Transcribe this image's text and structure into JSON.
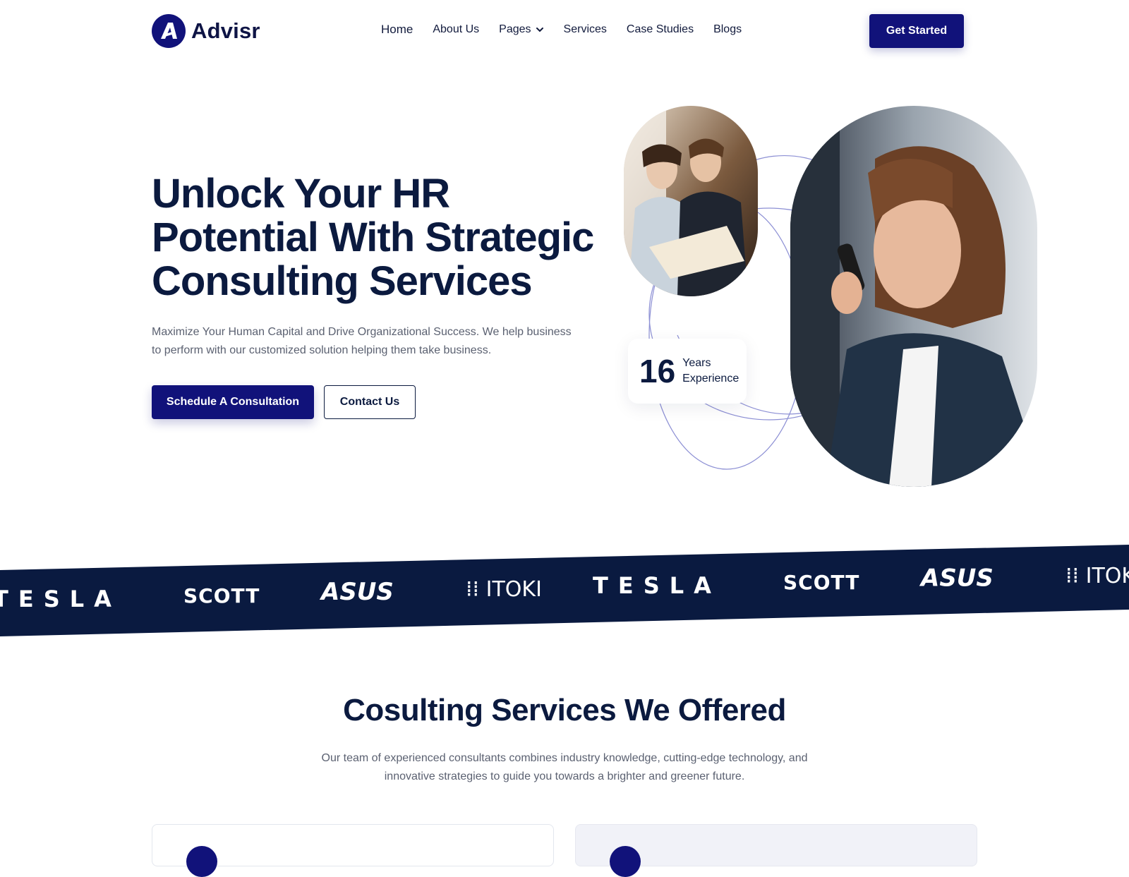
{
  "brand": {
    "name": "Advisr",
    "color": "#11127a",
    "dark": "#0b1a3f"
  },
  "nav": {
    "home": "Home",
    "about": "About Us",
    "pages": "Pages",
    "services": "Services",
    "case_studies": "Case Studies",
    "blogs": "Blogs",
    "cta": "Get Started"
  },
  "hero": {
    "title": "Unlock Your HR Potential With Strategic Consulting Services",
    "subtitle": "Maximize Your Human Capital and Drive Organizational Success. We help business to perform with our customized solution helping them take business.",
    "primary_button": "Schedule A Consultation",
    "secondary_button": "Contact Us",
    "experience": {
      "value": "16",
      "label": "Years Experience"
    }
  },
  "logos": [
    "TESLA",
    "SCOTT",
    "ASUS",
    "ITOKI",
    "TESLA",
    "SCOTT",
    "ASUS",
    "ITOKI"
  ],
  "services": {
    "title": "Cosulting Services We Offered",
    "subtitle": "Our team of experienced consultants combines industry knowledge, cutting-edge technology, and innovative strategies to guide you towards a brighter and greener future."
  }
}
